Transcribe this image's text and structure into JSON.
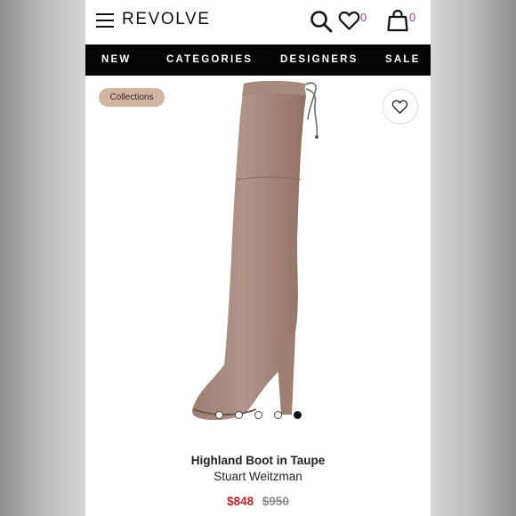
{
  "header": {
    "logo": "REVOLVE",
    "wishlist_count": "0",
    "bag_count": "0",
    "icons": [
      "menu-icon",
      "search-icon",
      "heart-icon",
      "bag-icon"
    ]
  },
  "nav": {
    "items": [
      "NEW",
      "CATEGORIES",
      "DESIGNERS",
      "SALE"
    ]
  },
  "badge": {
    "label": "Collections"
  },
  "gallery": {
    "slide_count": 5,
    "active_slide": 5
  },
  "product": {
    "name": "Highland Boot in Taupe",
    "brand": "Stuart Weitzman",
    "sale_price": "$848",
    "original_price": "$950"
  },
  "colors": {
    "accent_count": "#a6369c",
    "sale_price": "#b5222b",
    "nav_background": "#050505",
    "badge_background": "#d2b5a1",
    "boot_suede": "#a98b7c"
  }
}
